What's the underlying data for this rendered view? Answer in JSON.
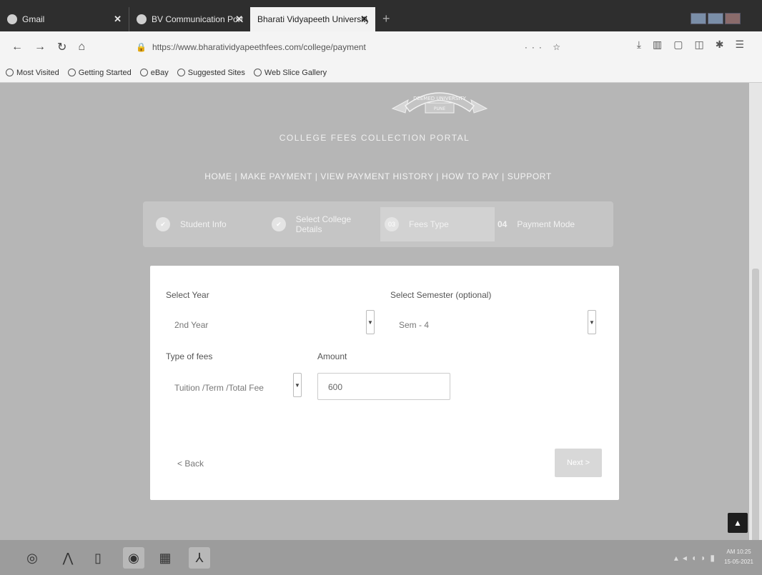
{
  "browser": {
    "tabs": [
      {
        "label": "Gmail"
      },
      {
        "label": "BV Communication Portal"
      },
      {
        "label": "Bharati Vidyapeeth University"
      }
    ],
    "url": "https://www.bharatividyapeethfees.com/college/payment",
    "bookmarks": [
      "Most Visited",
      "Getting Started",
      "eBay",
      "Suggested Sites",
      "Web Slice Gallery"
    ]
  },
  "site": {
    "emblem_text": "DEEMED UNIVERSITY",
    "emblem_sub": "PUNE",
    "portal_title": "COLLEGE FEES COLLECTION PORTAL",
    "nav": "HOME | MAKE PAYMENT | VIEW PAYMENT HISTORY | HOW TO PAY | SUPPORT"
  },
  "steps": [
    {
      "label": "Student Info",
      "marker": "✔"
    },
    {
      "label": "Select College Details",
      "marker": "✔"
    },
    {
      "label": "Fees Type",
      "marker": "03"
    },
    {
      "label": "Payment Mode",
      "marker": "04"
    }
  ],
  "form": {
    "year_label": "Select Year",
    "year_value": "2nd Year",
    "semester_label": "Select Semester (optional)",
    "semester_value": "Sem - 4",
    "fee_type_label": "Type of fees",
    "fee_type_value": "Tuition /Term /Total Fee",
    "amount_label": "Amount",
    "amount_value": "600",
    "back_label": "< Back",
    "next_label": "Next >"
  },
  "taskbar": {
    "clock_time": "AM 10:25",
    "clock_date": "15-05-2021"
  }
}
